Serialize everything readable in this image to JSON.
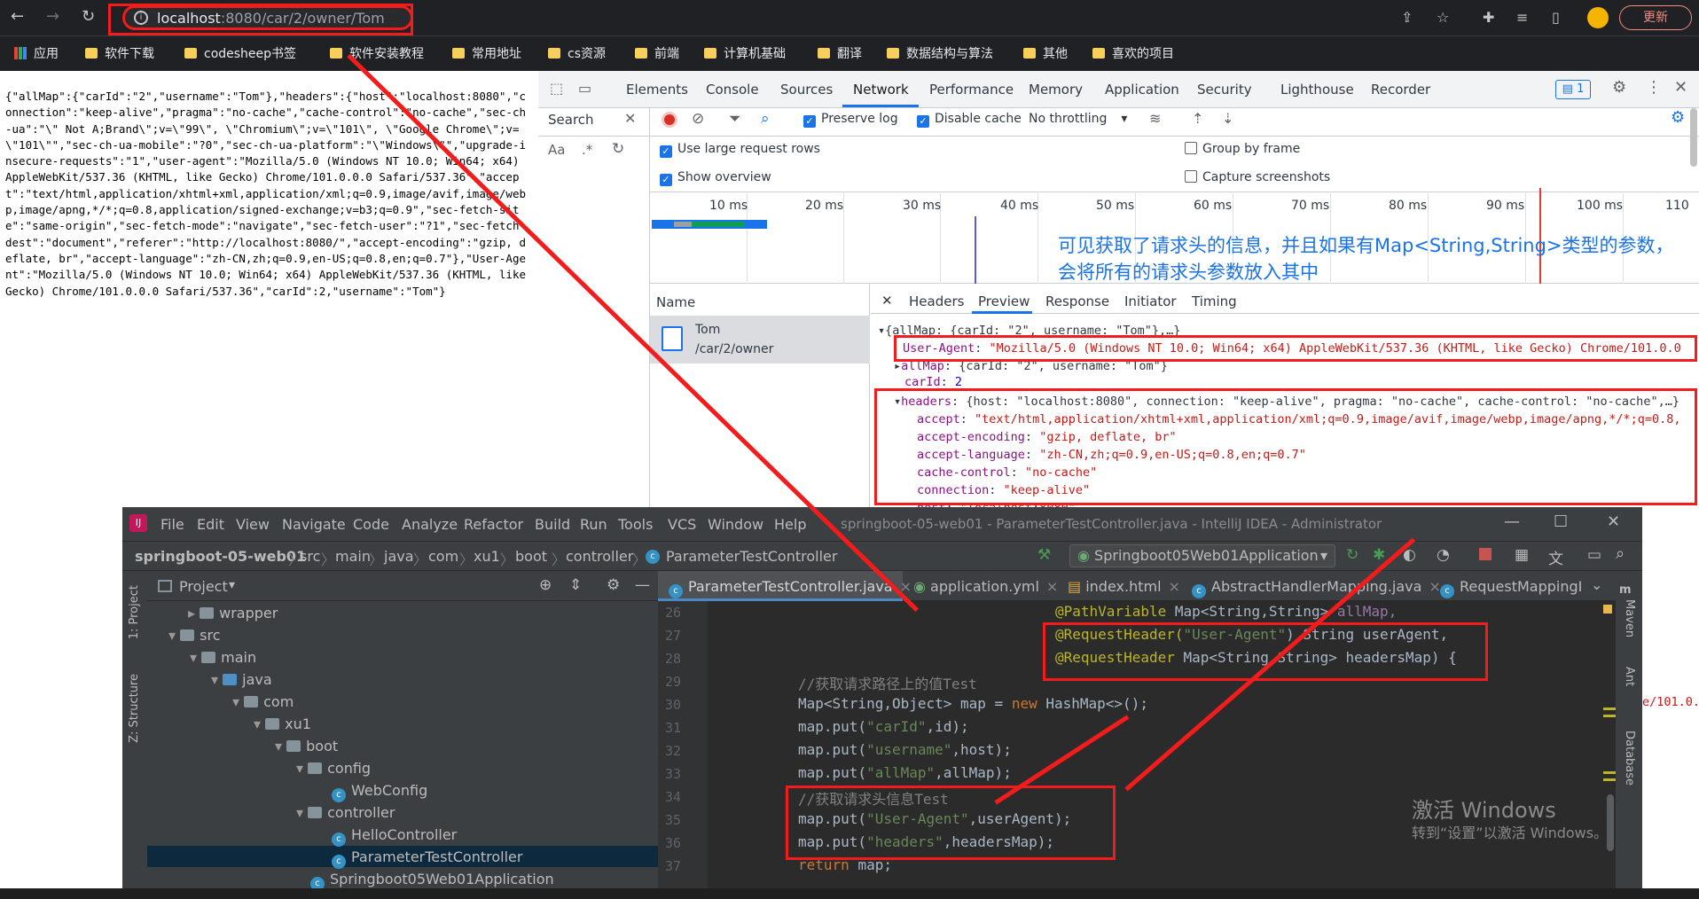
{
  "browser": {
    "url_host": "localhost",
    "url_path": ":8080/car/2/owner/Tom",
    "update_label": "更新"
  },
  "bookmarks": [
    "应用",
    "软件下载",
    "codesheep书签",
    "软件安装教程",
    "常用地址",
    "cs资源",
    "前端",
    "计算机基础",
    "翻译",
    "数据结构与算法",
    "其他",
    "喜欢的项目"
  ],
  "raw_json": "{\"allMap\":{\"carId\":\"2\",\"username\":\"Tom\"},\"headers\":{\"host\":\"localhost:8080\",\"connection\":\"keep-alive\",\"pragma\":\"no-cache\",\"cache-control\":\"no-cache\",\"sec-ch-ua\":\"\\\" Not A;Brand\\\";v=\\\"99\\\", \\\"Chromium\\\";v=\\\"101\\\", \\\"Google Chrome\\\";v=\\\"101\\\"\",\"sec-ch-ua-mobile\":\"?0\",\"sec-ch-ua-platform\":\"\\\"Windows\\\"\",\"upgrade-insecure-requests\":\"1\",\"user-agent\":\"Mozilla/5.0 (Windows NT 10.0; Win64; x64) AppleWebKit/537.36 (KHTML, like Gecko) Chrome/101.0.0.0 Safari/537.36\",\"accept\":\"text/html,application/xhtml+xml,application/xml;q=0.9,image/avif,image/webp,image/apng,*/*;q=0.8,application/signed-exchange;v=b3;q=0.9\",\"sec-fetch-site\":\"same-origin\",\"sec-fetch-mode\":\"navigate\",\"sec-fetch-user\":\"?1\",\"sec-fetch-dest\":\"document\",\"referer\":\"http://localhost:8080/\",\"accept-encoding\":\"gzip, deflate, br\",\"accept-language\":\"zh-CN,zh;q=0.9,en-US;q=0.8,en;q=0.7\"},\"User-Agent\":\"Mozilla/5.0 (Windows NT 10.0; Win64; x64) AppleWebKit/537.36 (KHTML, like Gecko) Chrome/101.0.0.0 Safari/537.36\",\"carId\":2,\"username\":\"Tom\"}",
  "devtools": {
    "tabs": [
      "Elements",
      "Console",
      "Sources",
      "Network",
      "Performance",
      "Memory",
      "Application",
      "Security",
      "Lighthouse",
      "Recorder"
    ],
    "issues_count": "1",
    "search_label": "Search",
    "preserve_log": "Preserve log",
    "disable_cache": "Disable cache",
    "throttling": "No throttling",
    "large_rows": "Use large request rows",
    "show_overview": "Show overview",
    "group_by_frame": "Group by frame",
    "capture_screenshots": "Capture screenshots",
    "ticks": [
      "10 ms",
      "20 ms",
      "30 ms",
      "40 ms",
      "50 ms",
      "60 ms",
      "70 ms",
      "80 ms",
      "90 ms",
      "100 ms",
      "110"
    ],
    "name_header": "Name",
    "request_name": "Tom",
    "request_path": "/car/2/owner",
    "detail_tabs": [
      "Headers",
      "Preview",
      "Response",
      "Initiator",
      "Timing"
    ],
    "preview": {
      "line0": "{allMap: {carId: \"2\", username: \"Tom\"},…}",
      "ua_key": "User-Agent",
      "ua_val": "\"Mozilla/5.0 (Windows NT 10.0; Win64; x64) AppleWebKit/537.36 (KHTML, like Gecko) Chrome/101.0.0",
      "allmap_key": "allMap",
      "allmap_val": "{carId: \"2\", username: \"Tom\"}",
      "carid_key": "carId",
      "carid_val": "2",
      "headers_key": "headers",
      "headers_val": "{host: \"localhost:8080\", connection: \"keep-alive\", pragma: \"no-cache\", cache-control: \"no-cache\",…}",
      "accept_key": "accept",
      "accept_val": "\"text/html,application/xhtml+xml,application/xml;q=0.9,image/avif,image/webp,image/apng,*/*;q=0.8,",
      "enc_key": "accept-encoding",
      "enc_val": "\"gzip, deflate, br\"",
      "lang_key": "accept-language",
      "lang_val": "\"zh-CN,zh;q=0.9,en-US;q=0.8,en;q=0.7\"",
      "cc_key": "cache-control",
      "cc_val": "\"no-cache\"",
      "conn_key": "connection",
      "conn_val": "\"keep-alive\"",
      "host_key": "host",
      "host_val": "\"localhost:8080\""
    }
  },
  "annotation": "可见获取了请求头的信息，并且如果有Map<String,String>类型的参数，会将所有的请求头参数放入其中",
  "ide": {
    "menu": [
      "File",
      "Edit",
      "View",
      "Navigate",
      "Code",
      "Analyze",
      "Refactor",
      "Build",
      "Run",
      "Tools",
      "VCS",
      "Window",
      "Help"
    ],
    "title": "springboot-05-web01 - ParameterTestController.java - IntelliJ IDEA - Administrator",
    "breadcrumbs": [
      "springboot-05-web01",
      "src",
      "main",
      "java",
      "com",
      "xu1",
      "boot",
      "controller",
      "ParameterTestController"
    ],
    "run_config": "Springboot05Web01Application",
    "project_label": "Project",
    "side_project": "1: Project",
    "side_structure": "Z: Structure",
    "side_maven": "Maven",
    "side_ant": "Ant",
    "side_database": "Database",
    "tree": [
      "wrapper",
      "src",
      "main",
      "java",
      "com",
      "xu1",
      "boot",
      "config",
      "WebConfig",
      "controller",
      "HelloController",
      "ParameterTestController",
      "Springboot05Web01Application"
    ],
    "editor_tabs": [
      "ParameterTestController.java",
      "application.yml",
      "index.html",
      "AbstractHandlerMapping.java",
      "RequestMappingIn"
    ],
    "line_numbers": [
      "26",
      "27",
      "28",
      "29",
      "30",
      "31",
      "32",
      "33",
      "34",
      "35",
      "36",
      "37"
    ],
    "code": {
      "l26a": "@PathVariable ",
      "l26b": "Map<String,String> ",
      "l26c": "allMap,",
      "l27a": "@RequestHeader(",
      "l27b": "\"User-Agent\"",
      "l27c": ") String userAgent,",
      "l28a": "@RequestHeader ",
      "l28b": "Map<String,String> headersMap) {",
      "l29": "//获取请求路径上的值Test",
      "l30a": "Map<String,Object> map = ",
      "l30b": "new ",
      "l30c": "HashMap<>();",
      "l31a": "map.put(",
      "l31b": "\"carId\"",
      "l31c": ",id);",
      "l32a": "map.put(",
      "l32b": "\"username\"",
      "l32c": ",host);",
      "l33a": "map.put(",
      "l33b": "\"allMap\"",
      "l33c": ",allMap);",
      "l34": "//获取请求头信息Test",
      "l35a": "map.put(",
      "l35b": "\"User-Agent\"",
      "l35c": ",userAgent);",
      "l36a": "map.put(",
      "l36b": "\"headers\"",
      "l36c": ",headersMap);",
      "l37a": "return ",
      "l37b": "map;"
    },
    "right_frag": "e/101.0.0",
    "watermark_title": "激活 Windows",
    "watermark_sub": "转到“设置”以激活 Windows。"
  },
  "colors": {
    "accent": "#1a73e8",
    "highlight_red": "#f31c1c"
  }
}
